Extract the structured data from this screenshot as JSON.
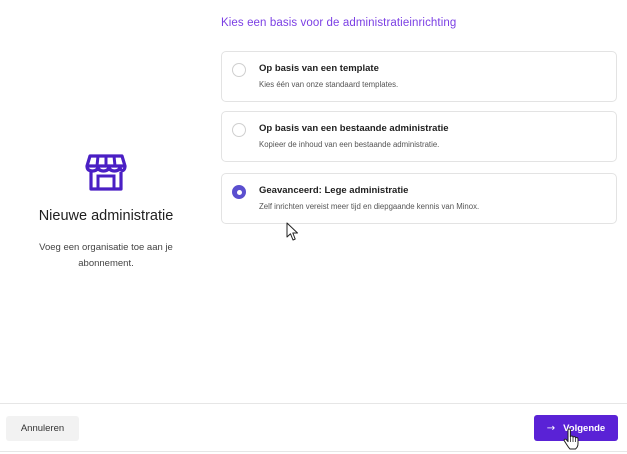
{
  "window": {
    "heading": "Kies een basis voor de administratieinrichting"
  },
  "sidebar": {
    "icon": "store-icon",
    "title": "Nieuwe administratie",
    "description": "Voeg een organisatie toe aan je abonnement."
  },
  "options": [
    {
      "title": "Op basis van een template",
      "description": "Kies één van onze standaard templates.",
      "selected": false
    },
    {
      "title": "Op basis van een bestaande administratie",
      "description": "Kopieer de inhoud van een bestaande administratie.",
      "selected": false
    },
    {
      "title": "Geavanceerd: Lege administratie",
      "description": "Zelf inrichten vereist meer tijd en diepgaande kennis van Minox.",
      "selected": true
    }
  ],
  "footer": {
    "cancel_label": "Annuleren",
    "next_label": "Volgende",
    "next_icon": "arrow-right-icon"
  },
  "colors": {
    "accent": "#5a22d6",
    "heading": "#7b3fe4",
    "radio_selected": "#5b4fcf"
  }
}
